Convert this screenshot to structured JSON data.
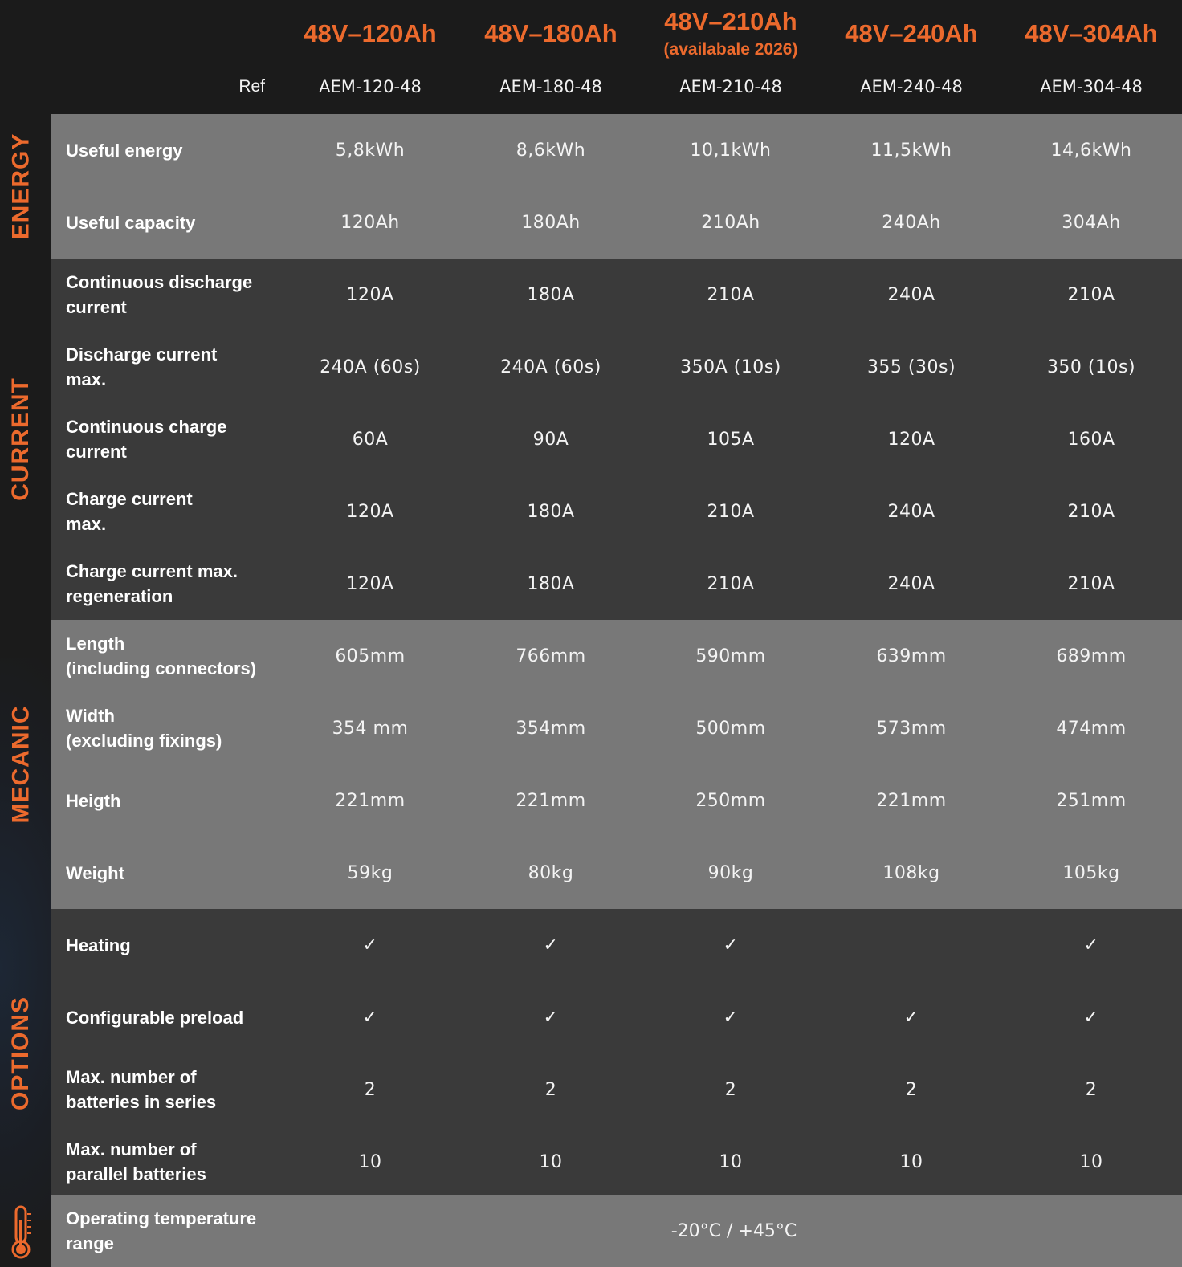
{
  "header": {
    "ref_label": "Ref",
    "models": [
      {
        "name": "48V–120Ah",
        "note": "",
        "ref": "AEM-120-48"
      },
      {
        "name": "48V–180Ah",
        "note": "",
        "ref": "AEM-180-48"
      },
      {
        "name": "48V–210Ah",
        "note": "(availabale 2026)",
        "ref": "AEM-210-48"
      },
      {
        "name": "48V–240Ah",
        "note": "",
        "ref": "AEM-240-48"
      },
      {
        "name": "48V–304Ah",
        "note": "",
        "ref": "AEM-304-48"
      }
    ]
  },
  "sections": {
    "energy": {
      "title": "ENERGY",
      "rows": [
        {
          "label": "Useful energy",
          "values": [
            "5,8kWh",
            "8,6kWh",
            "10,1kWh",
            "11,5kWh",
            "14,6kWh"
          ]
        },
        {
          "label": "Useful capacity",
          "values": [
            "120Ah",
            "180Ah",
            "210Ah",
            "240Ah",
            "304Ah"
          ]
        }
      ]
    },
    "current": {
      "title": "CURRENT",
      "rows": [
        {
          "label": "Continuous discharge\ncurrent",
          "values": [
            "120A",
            "180A",
            "210A",
            "240A",
            "210A"
          ]
        },
        {
          "label": "Discharge current\nmax.",
          "values": [
            "240A (60s)",
            "240A (60s)",
            "350A (10s)",
            "355 (30s)",
            "350 (10s)"
          ]
        },
        {
          "label": "Continuous charge\ncurrent",
          "values": [
            "60A",
            "90A",
            "105A",
            "120A",
            "160A"
          ]
        },
        {
          "label": "Charge current\nmax.",
          "values": [
            "120A",
            "180A",
            "210A",
            "240A",
            "210A"
          ]
        },
        {
          "label": "Charge current max.\nregeneration",
          "values": [
            "120A",
            "180A",
            "210A",
            "240A",
            "210A"
          ]
        }
      ]
    },
    "mecanic": {
      "title": "MECANIC",
      "rows": [
        {
          "label": "Length\n(including connectors)",
          "values": [
            "605mm",
            "766mm",
            "590mm",
            "639mm",
            "689mm"
          ]
        },
        {
          "label": "Width\n(excluding fixings)",
          "values": [
            "354 mm",
            "354mm",
            "500mm",
            "573mm",
            "474mm"
          ]
        },
        {
          "label": "Heigth",
          "values": [
            "221mm",
            "221mm",
            "250mm",
            "221mm",
            "251mm"
          ]
        },
        {
          "label": "Weight",
          "values": [
            "59kg",
            "80kg",
            "90kg",
            "108kg",
            "105kg"
          ]
        }
      ]
    },
    "options": {
      "title": "OPTIONS",
      "rows": [
        {
          "label": "Heating",
          "values": [
            "✓",
            "✓",
            "✓",
            "",
            "✓"
          ]
        },
        {
          "label": "Configurable preload",
          "values": [
            "✓",
            "✓",
            "✓",
            "✓",
            "✓"
          ]
        },
        {
          "label": "Max. number of\nbatteries in series",
          "values": [
            "2",
            "2",
            "2",
            "2",
            "2"
          ]
        },
        {
          "label": "Max. number of\nparallel batteries",
          "values": [
            "10",
            "10",
            "10",
            "10",
            "10"
          ]
        }
      ]
    }
  },
  "temperature": {
    "label": "Operating temperature\nrange",
    "value": "-20°C /  +45°C",
    "icon": "thermometer-icon"
  },
  "colors": {
    "accent": "#ec6a2d",
    "background": "#1b1b1b",
    "row_light": "#787878",
    "row_dark": "#3a3a3a"
  }
}
